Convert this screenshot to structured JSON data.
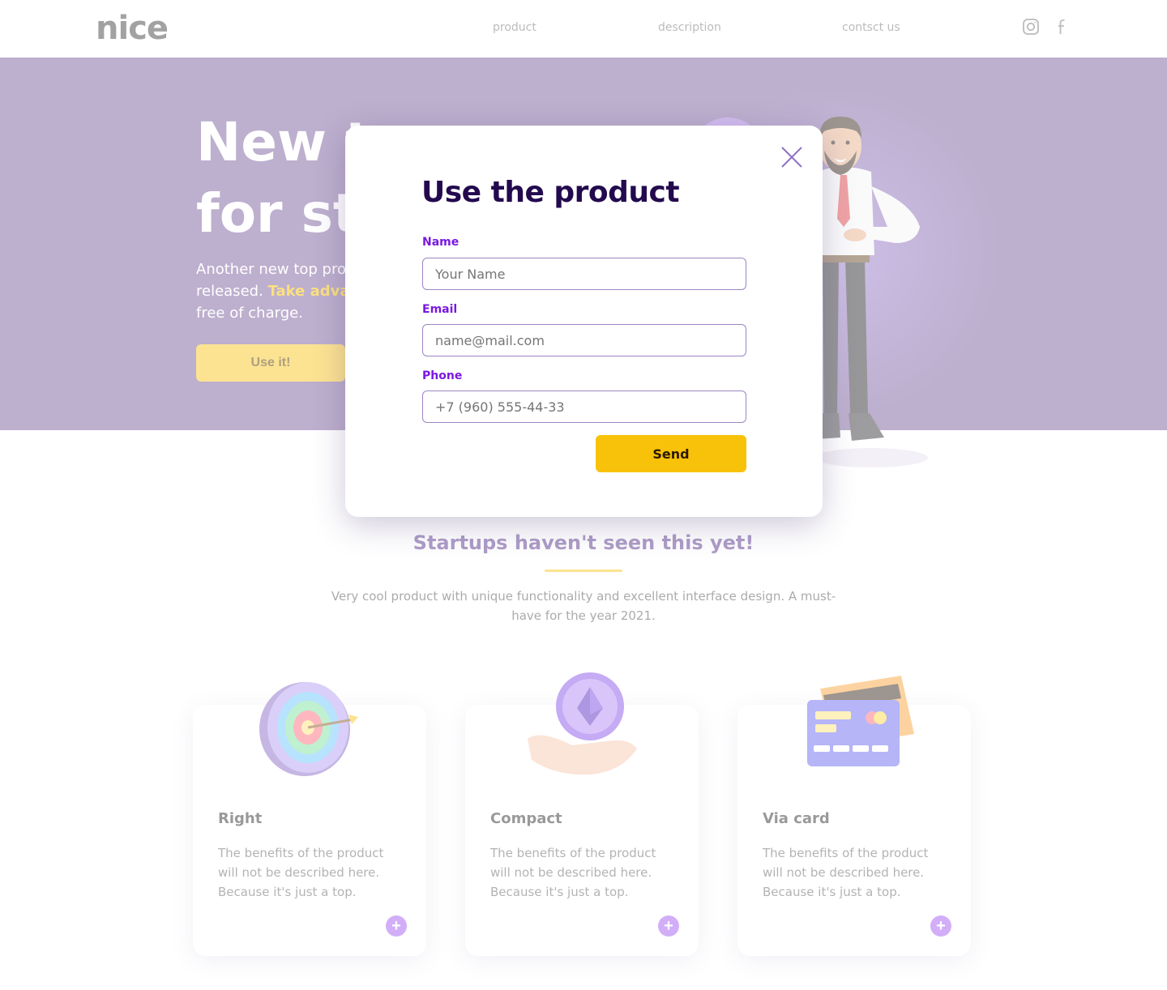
{
  "header": {
    "logo": "nice",
    "nav": [
      "product",
      "description",
      "contsct us"
    ],
    "social": [
      "instagram-icon",
      "facebook-icon"
    ]
  },
  "hero": {
    "title_line1": "New t",
    "title_line2": "for st",
    "sub_line1": "Another new top prod",
    "sub_line2_a": "released. ",
    "sub_line2_b": "Take advan",
    "sub_line3": "free of charge.",
    "button": "Use it!"
  },
  "section": {
    "title": "Startups haven't seen this yet!",
    "text": "Very cool product with unique functionality and excellent interface design. A must-have for the year 2021."
  },
  "cards": [
    {
      "title": "Right",
      "text": "The benefits of the product will not be described here. Because it's just a top.",
      "icon": "target-icon"
    },
    {
      "title": "Compact",
      "text": "The benefits of the product will not be described here. Because it's just a top.",
      "icon": "coin-hand-icon"
    },
    {
      "title": "Via card",
      "text": "The benefits of the product will not be described here. Because it's just a top.",
      "icon": "credit-card-icon"
    }
  ],
  "modal": {
    "title": "Use the product",
    "name_label": "Name",
    "name_placeholder": "Your Name",
    "email_label": "Email",
    "email_placeholder": "name@mail.com",
    "phone_label": "Phone",
    "phone_placeholder": "+7 (960) 555-44-33",
    "send": "Send"
  },
  "colors": {
    "accent": "#7a18e0",
    "yellow": "#f9c20a",
    "hero_bg": "#7a5f9c",
    "dark_title": "#230a4e"
  }
}
